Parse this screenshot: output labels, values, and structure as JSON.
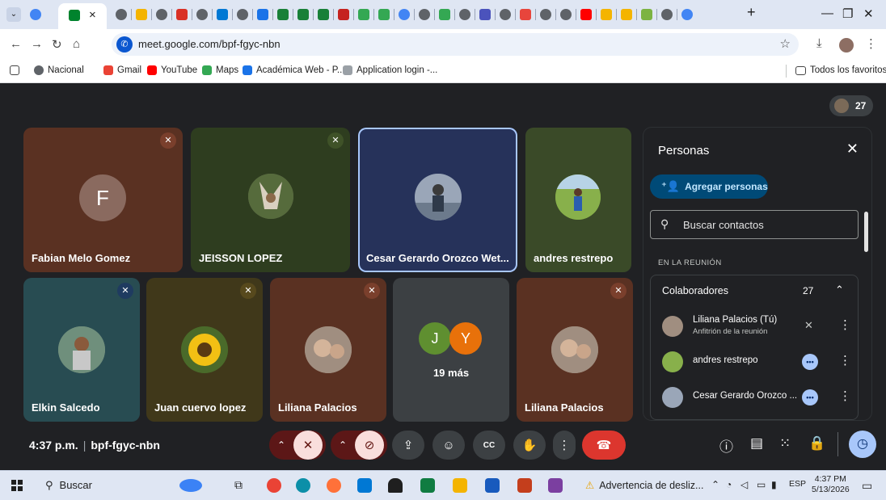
{
  "browser": {
    "active_tab_close": "×",
    "new_tab": "+",
    "url": "meet.google.com/bpf-fgyc-nbn",
    "bookmarks": [
      "Nacional",
      "Gmail",
      "YouTube",
      "Maps",
      "Académica Web - P...",
      "Application login -..."
    ],
    "all_bookmarks": "Todos los favoritos"
  },
  "meet": {
    "participant_count": "27",
    "tiles": [
      {
        "name": "Fabian Melo Gomez",
        "initial": "F",
        "muted": true
      },
      {
        "name": "JEISSON LOPEZ",
        "muted": true
      },
      {
        "name": "Cesar Gerardo Orozco Wet...",
        "muted": false
      },
      {
        "name": "andres restrepo",
        "muted": false
      },
      {
        "name": "Elkin Salcedo",
        "muted": true
      },
      {
        "name": "Juan cuervo lopez",
        "muted": true
      },
      {
        "name": "Liliana Palacios",
        "muted": true
      },
      {
        "name": "19 más",
        "initials": [
          "J",
          "Y"
        ]
      },
      {
        "name": "Liliana Palacios",
        "muted": true
      }
    ],
    "time": "4:37 p.m.",
    "separator": "|",
    "meeting_code": "bpf-fgyc-nbn"
  },
  "panel": {
    "title": "Personas",
    "add_label": "Agregar personas",
    "search_placeholder": "Buscar contactos",
    "section_label": "EN LA REUNIÓN",
    "group_label": "Colaboradores",
    "group_count": "27",
    "people": [
      {
        "name": "Liliana Palacios (Tú)",
        "role": "Anfitrión de la reunión"
      },
      {
        "name": "andres restrepo"
      },
      {
        "name": "Cesar Gerardo Orozco ..."
      }
    ]
  },
  "taskbar": {
    "search": "Buscar",
    "warning": "Advertencia de desliz...",
    "language": "ESP",
    "time": "4:37 PM",
    "date": "5/13/2026"
  },
  "colors": {
    "meet_bg": "#202124",
    "tile_brown": "#5a3122",
    "tile_green": "#2e3d1f",
    "tile_blue": "#26325a",
    "tile_teal": "#284c52",
    "tile_olive": "#40381a",
    "hangup": "#dc362e",
    "accent": "#a8c7fa"
  }
}
